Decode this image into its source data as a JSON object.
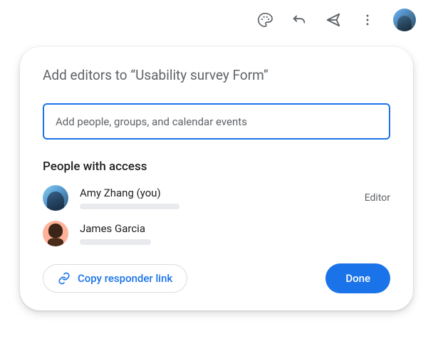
{
  "dialog": {
    "title": "Add editors to “Usability survey Form”",
    "input_placeholder": "Add people, groups, and calendar events",
    "section_title": "People with access",
    "people": [
      {
        "name": "Amy Zhang (you)",
        "role": "Editor"
      },
      {
        "name": "James Garcia",
        "role": ""
      }
    ],
    "copy_link_label": "Copy responder link",
    "done_label": "Done"
  },
  "colors": {
    "primary": "#1a73e8",
    "text_secondary": "#5f6368"
  }
}
